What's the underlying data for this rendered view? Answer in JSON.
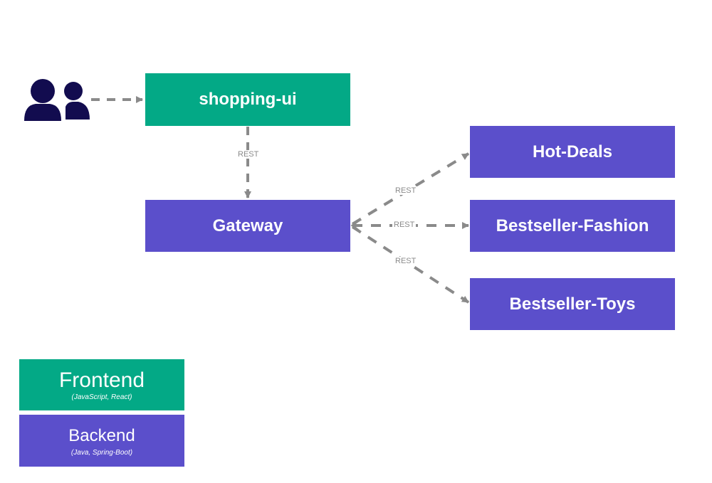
{
  "diagram": {
    "users_icon": "users-icon",
    "nodes": {
      "shopping_ui": "shopping-ui",
      "gateway": "Gateway",
      "hot_deals": "Hot-Deals",
      "bestseller_fashion": "Bestseller-Fashion",
      "bestseller_toys": "Bestseller-Toys"
    },
    "edges": [
      {
        "from": "users",
        "to": "shopping-ui",
        "label": ""
      },
      {
        "from": "shopping-ui",
        "to": "Gateway",
        "label": "REST"
      },
      {
        "from": "Gateway",
        "to": "Hot-Deals",
        "label": "REST"
      },
      {
        "from": "Gateway",
        "to": "Bestseller-Fashion",
        "label": "REST"
      },
      {
        "from": "Gateway",
        "to": "Bestseller-Toys",
        "label": "REST"
      }
    ],
    "legend": {
      "frontend": {
        "title": "Frontend",
        "subtitle": "(JavaScript, React)"
      },
      "backend": {
        "title": "Backend",
        "subtitle": "(Java, Spring-Boot)"
      }
    },
    "colors": {
      "frontend": "#03a986",
      "backend": "#5b4fcb",
      "arrow": "#8a8a8a",
      "users": "#120c4f"
    }
  }
}
